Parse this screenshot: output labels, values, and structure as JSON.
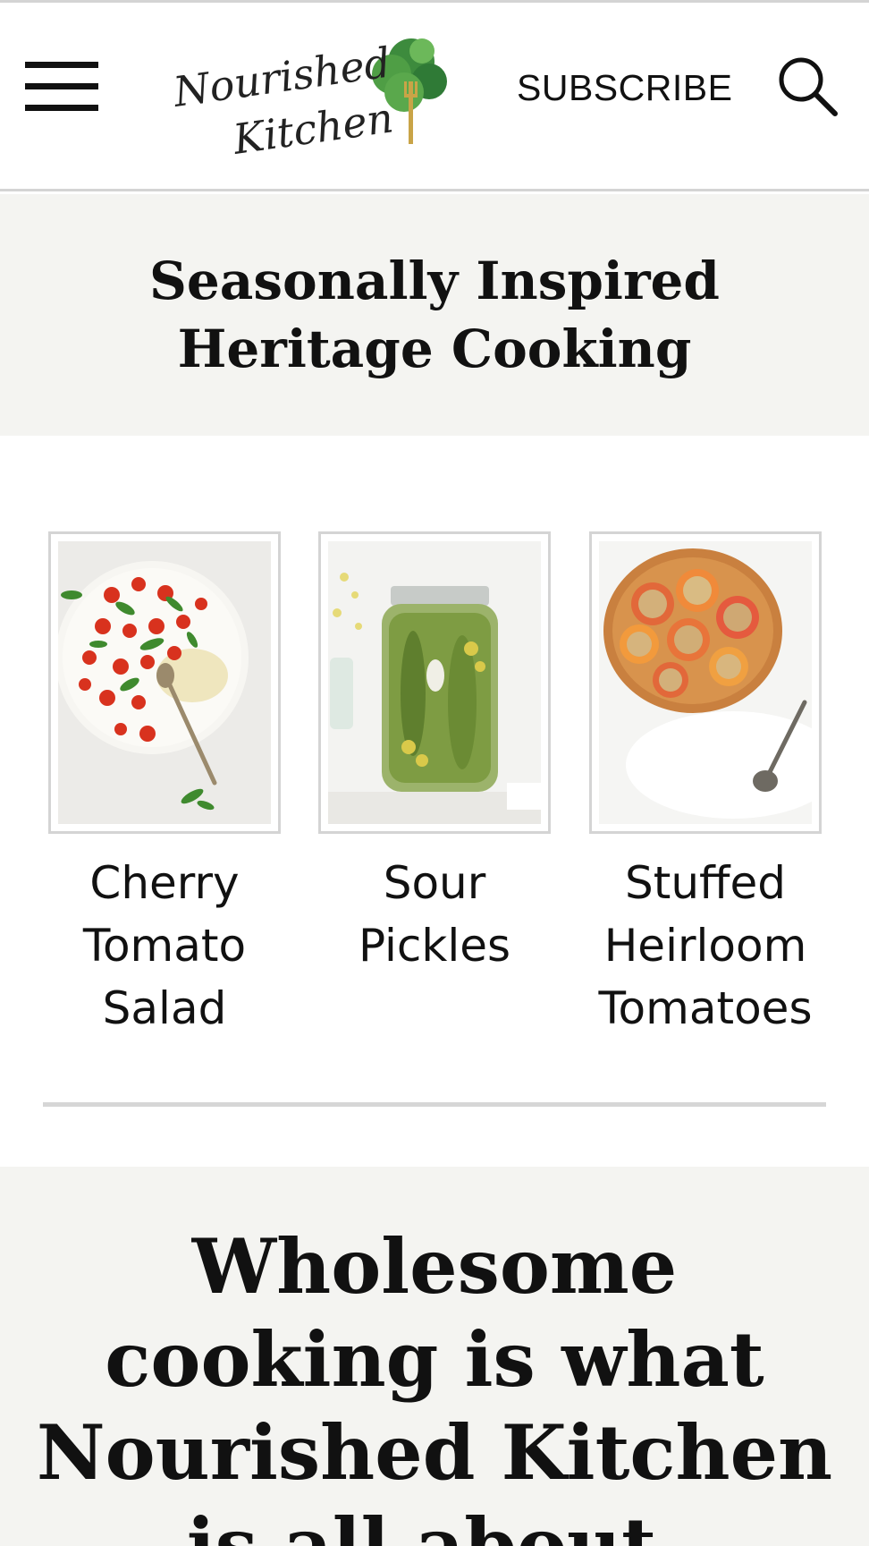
{
  "header": {
    "logo_line1": "Nourished",
    "logo_line2": "Kitchen",
    "subscribe_label": "SUBSCRIBE",
    "menu_icon": "hamburger-menu-icon",
    "search_icon": "search-icon"
  },
  "tagline": "Seasonally Inspired Heritage Cooking",
  "recipes": [
    {
      "title": "Cherry Tomato Salad",
      "image": "cherry-tomato-salad-photo"
    },
    {
      "title": "Sour Pickles",
      "image": "sour-pickles-photo"
    },
    {
      "title": "Stuffed Heirloom Tomatoes",
      "image": "stuffed-heirloom-tomatoes-photo"
    }
  ],
  "intro_heading": "Wholesome cooking is what Nourished Kitchen is all about.",
  "colors": {
    "band_bg": "#f4f4f1",
    "border": "#d4d4d4",
    "text": "#111111",
    "logo_green": "#3d8b3d",
    "logo_fork": "#c9a447"
  }
}
